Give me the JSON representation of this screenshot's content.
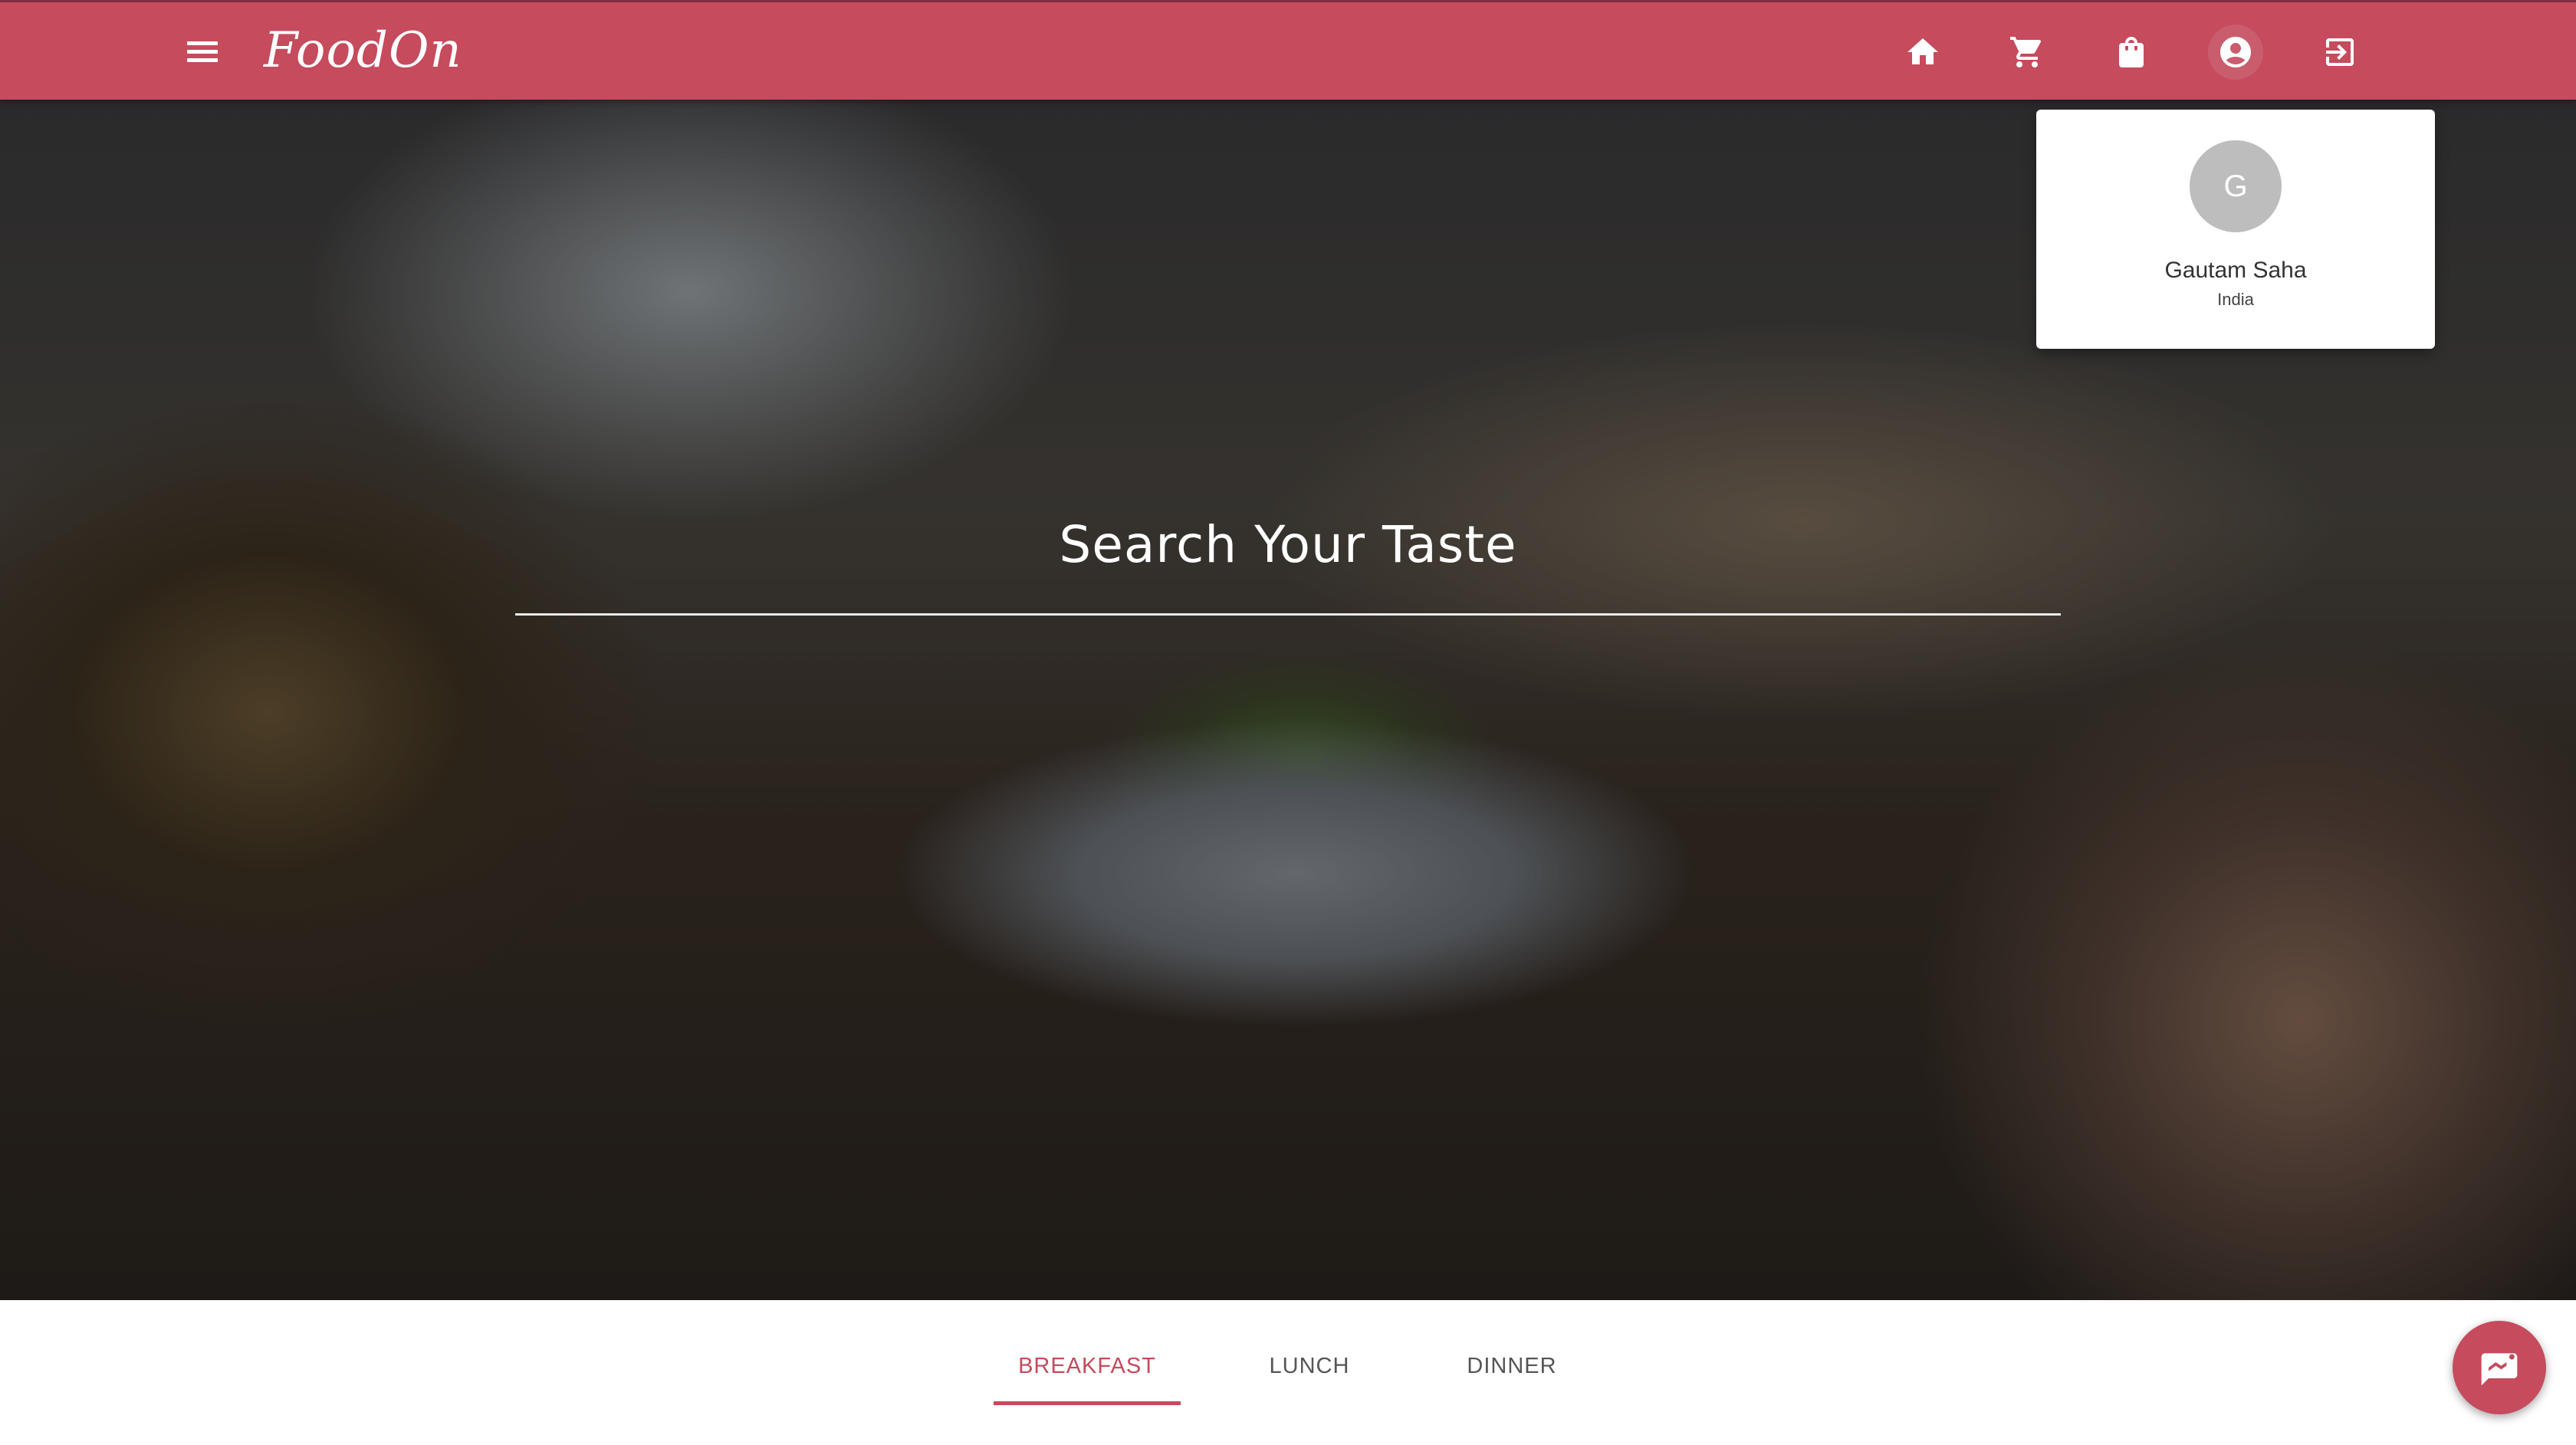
{
  "app": {
    "brand": "FoodOn",
    "accent_color": "#c54b5d"
  },
  "header": {
    "menu_icon": "menu-icon",
    "nav": [
      {
        "name": "home",
        "icon": "home-icon"
      },
      {
        "name": "cart",
        "icon": "cart-icon"
      },
      {
        "name": "orders",
        "icon": "shopping-bag-icon"
      },
      {
        "name": "account",
        "icon": "account-circle-icon",
        "active": true
      },
      {
        "name": "logout",
        "icon": "logout-icon"
      }
    ]
  },
  "hero": {
    "title": "Search Your Taste"
  },
  "profile": {
    "avatar_initial": "G",
    "name": "Gautam Saha",
    "country": "India"
  },
  "tabs": {
    "items": [
      "BREAKFAST",
      "LUNCH",
      "DINNER"
    ],
    "selected": "BREAKFAST"
  },
  "fab": {
    "icon": "chat-icon"
  }
}
